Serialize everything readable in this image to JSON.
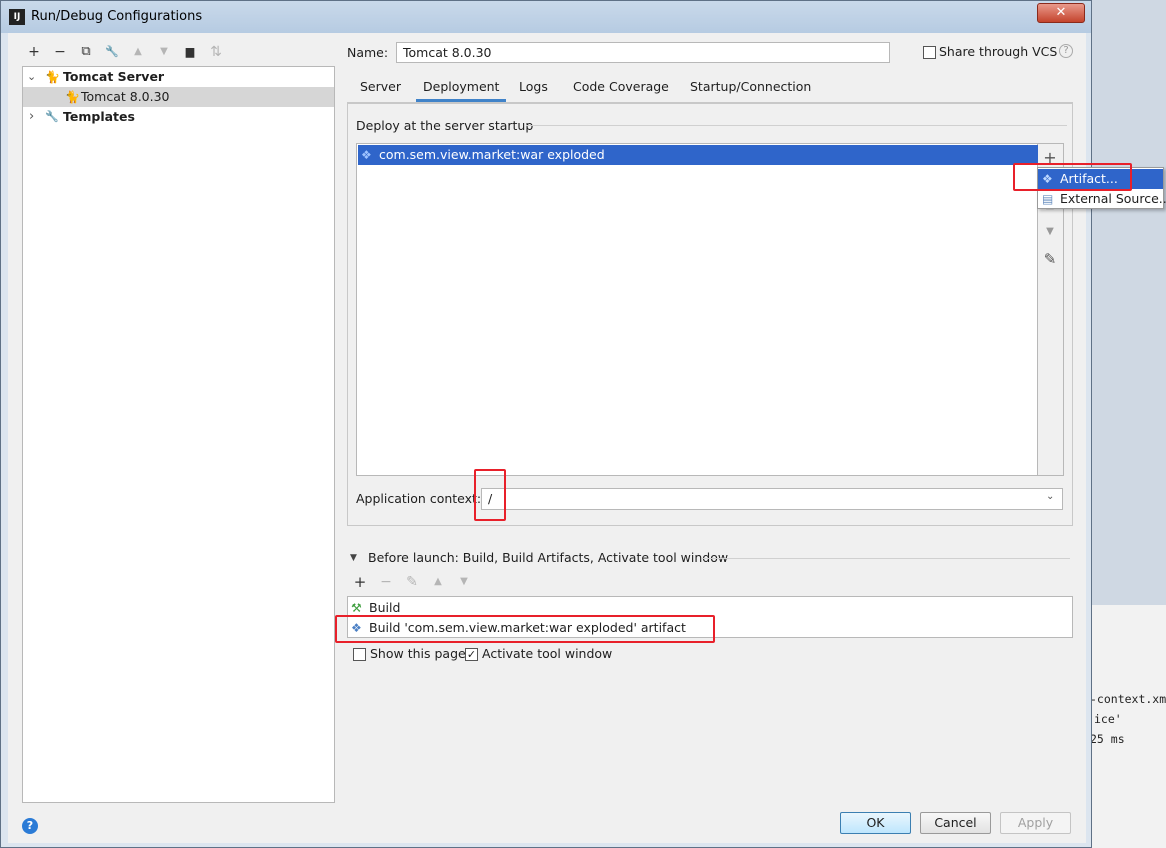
{
  "window": {
    "title": "Run/Debug Configurations",
    "close_label": "✕"
  },
  "toolbar": {
    "buttons": [
      {
        "name": "add-icon",
        "glyph": "+"
      },
      {
        "name": "remove-icon",
        "glyph": "−"
      },
      {
        "name": "copy-icon",
        "glyph": "⧉"
      },
      {
        "name": "wrench-icon",
        "glyph": "🔧"
      },
      {
        "name": "move-up-icon",
        "glyph": "▲"
      },
      {
        "name": "move-down-icon",
        "glyph": "▼"
      },
      {
        "name": "folder-icon",
        "glyph": "▆"
      },
      {
        "name": "sort-icon",
        "glyph": "⇅"
      }
    ]
  },
  "tree": {
    "items": [
      {
        "label": "Tomcat Server",
        "arrow": "⌄",
        "icon": "tomcat-icon"
      },
      {
        "label": "Tomcat 8.0.30",
        "icon": "tomcat-icon"
      },
      {
        "label": "Templates",
        "arrow": "›",
        "icon": "wrench-icon"
      }
    ]
  },
  "config": {
    "name_label": "Name:",
    "name_value": "Tomcat 8.0.30",
    "share_label": "Share through VCS",
    "help_glyph": "?"
  },
  "tabs": [
    {
      "label": "Server"
    },
    {
      "label": "Deployment"
    },
    {
      "label": "Logs"
    },
    {
      "label": "Code Coverage"
    },
    {
      "label": "Startup/Connection"
    }
  ],
  "deployment": {
    "section_title": "Deploy at the server startup",
    "items": [
      "com.sem.view.market:war exploded"
    ],
    "side_buttons": [
      "+",
      "−",
      "▲",
      "▼",
      "✎"
    ],
    "context_label": "Application context:",
    "context_value": "/"
  },
  "popup_menu": {
    "items": [
      {
        "label": "Artifact...",
        "selected": true
      },
      {
        "label": "External Source..."
      }
    ]
  },
  "before_launch": {
    "title": "Before launch: Build, Build Artifacts, Activate tool window",
    "toolbar": [
      "+",
      "−",
      "✎",
      "▲",
      "▼"
    ],
    "items": [
      {
        "label": "Build"
      },
      {
        "label": "Build 'com.sem.view.market:war exploded' artifact"
      }
    ],
    "show_page_label": "Show this page",
    "show_page_checked": false,
    "activate_label": "Activate tool window",
    "activate_checked": true
  },
  "buttons": {
    "ok": "OK",
    "cancel": "Cancel",
    "apply": "Apply",
    "help": "?"
  },
  "background_code": {
    "lines": [
      "-context.xm",
      "ice'",
      "25 ms"
    ]
  },
  "colors": {
    "highlight_box": "#e8202a",
    "selection": "#2f65ca"
  }
}
